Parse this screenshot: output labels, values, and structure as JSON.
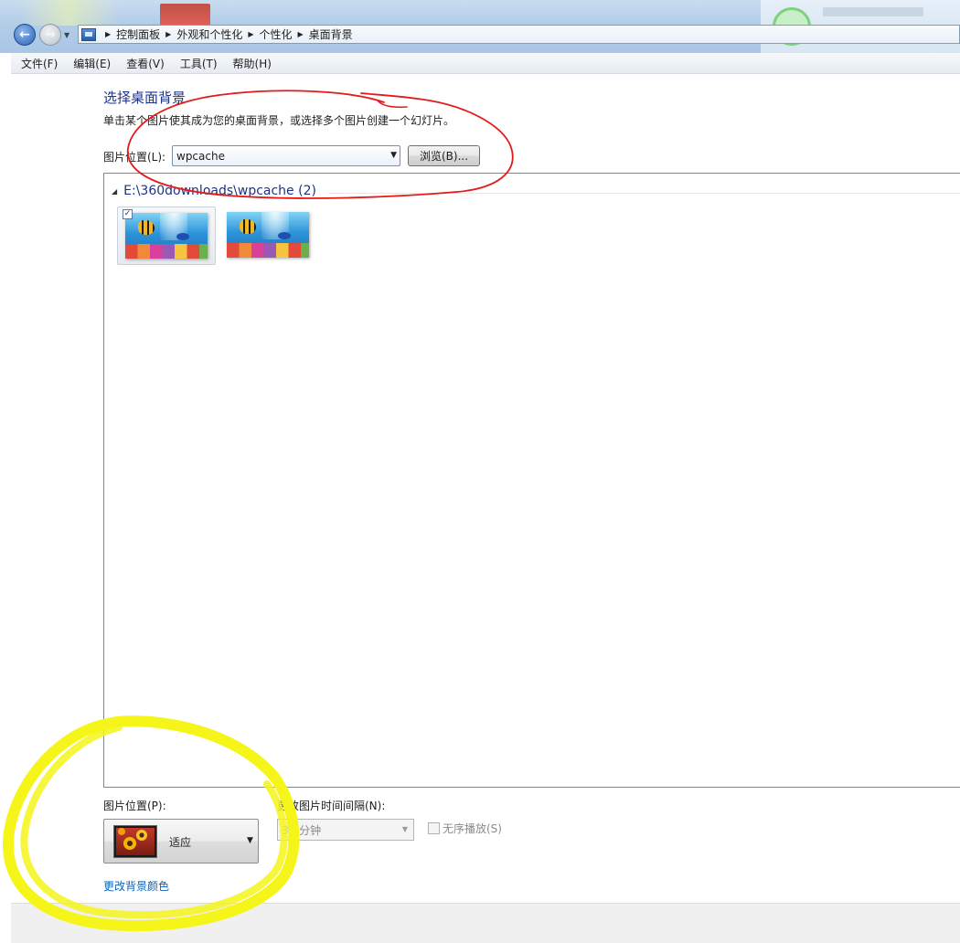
{
  "address_bar": {
    "crumbs": [
      "控制面板",
      "外观和个性化",
      "个性化",
      "桌面背景"
    ]
  },
  "menu": [
    "文件(F)",
    "编辑(E)",
    "查看(V)",
    "工具(T)",
    "帮助(H)"
  ],
  "main": {
    "title": "选择桌面背景",
    "description": "单击某个图片使其成为您的桌面背景，或选择多个图片创建一个幻灯片。",
    "location_label": "图片位置(L):",
    "location_value": "wpcache",
    "browse_label": "浏览(B)...",
    "group_header": "E:\\360downloads\\wpcache (2)",
    "thumbnails": [
      {
        "checked": true,
        "icon": "underwater-fish-wallpaper"
      },
      {
        "checked": false,
        "icon": "underwater-fish-wallpaper"
      }
    ]
  },
  "options": {
    "picture_position_label": "图片位置(P):",
    "picture_position_value": "适应",
    "interval_label": "更改图片时间间隔(N):",
    "interval_value": "30 分钟",
    "shuffle_label": "无序播放(S)",
    "shuffle_checked": false,
    "change_color_link": "更改背景颜色"
  },
  "annotations": {
    "red_ellipse_color": "#e31b1b",
    "yellow_ellipse_color": "#f5f51a"
  },
  "colors": {
    "title_blue": "#1e3287",
    "link_blue": "#0b63bf"
  }
}
